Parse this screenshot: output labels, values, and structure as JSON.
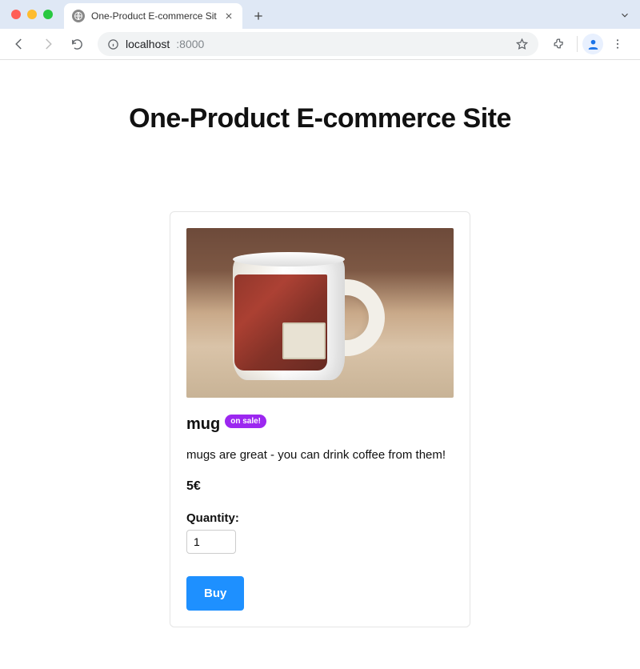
{
  "browser": {
    "tab_title": "One-Product E-commerce Sit",
    "url_host": "localhost",
    "url_port": ":8000"
  },
  "page": {
    "title": "One-Product E-commerce Site"
  },
  "product": {
    "name": "mug",
    "badge": "on sale!",
    "description": "mugs are great - you can drink coffee from them!",
    "price": "5€",
    "quantity_label": "Quantity:",
    "quantity_value": "1",
    "buy_label": "Buy"
  }
}
